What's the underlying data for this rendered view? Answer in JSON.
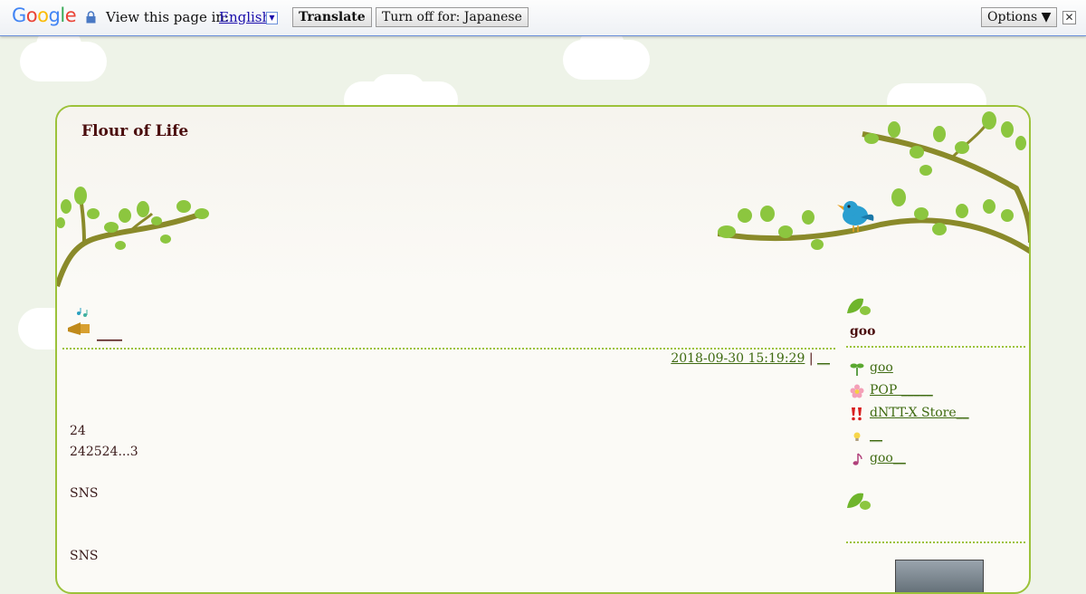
{
  "translate_bar": {
    "logo": "Google",
    "prompt": "View this page in:",
    "language": "English",
    "translate_label": "Translate",
    "turn_off_label": "Turn off for: Japanese",
    "options_label": "Options ▼",
    "close_glyph": "✕"
  },
  "blog": {
    "title": "Flour of Life"
  },
  "entry": {
    "title": "____",
    "datetime": "2018-09-30 15:19:29",
    "separator": "|",
    "category": "__",
    "lines": [
      "24",
      "242524...3",
      "SNS",
      "SNS"
    ]
  },
  "sidebar": {
    "title": "goo",
    "links": [
      {
        "label": "goo",
        "icon": "sprout-icon"
      },
      {
        "label": "POP _____",
        "icon": "flower-icon"
      },
      {
        "label": "dNTT-X Store__",
        "icon": "exclamation-icon"
      },
      {
        "label": "__",
        "icon": "lightbulb-icon"
      },
      {
        "label": "goo__",
        "icon": "music-note-icon"
      }
    ]
  },
  "colors": {
    "accent_green": "#9cc23a",
    "link_green": "#3e6a10",
    "title_brown": "#4a0c0c",
    "background": "#eef3e8"
  }
}
